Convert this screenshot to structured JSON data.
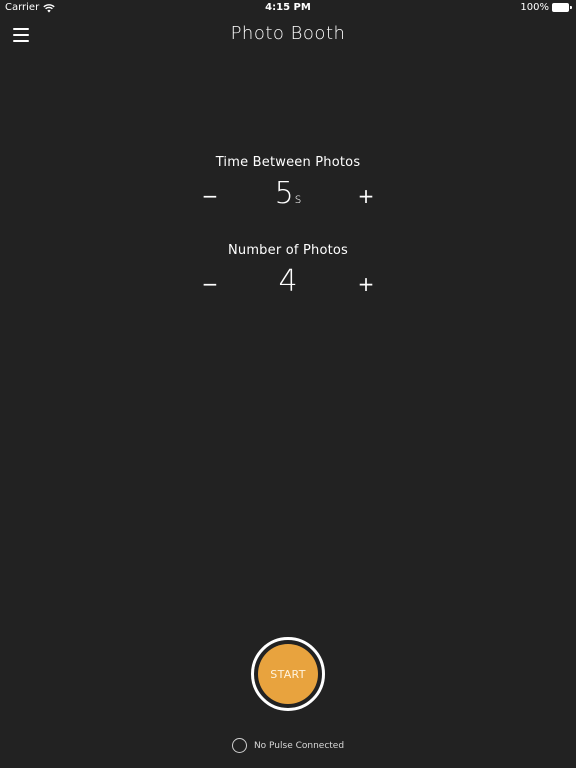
{
  "status_bar": {
    "carrier": "Carrier",
    "time": "4:15 PM",
    "battery": "100%"
  },
  "header": {
    "title": "Photo Booth"
  },
  "settings": {
    "time_between": {
      "label": "Time Between Photos",
      "value": "5",
      "unit": "s",
      "decrement": "−",
      "increment": "+"
    },
    "number_of_photos": {
      "label": "Number of Photos",
      "value": "4",
      "decrement": "−",
      "increment": "+"
    }
  },
  "start_button": {
    "label": "START",
    "color": "#e8a33e"
  },
  "pulse": {
    "status": "No Pulse Connected"
  },
  "colors": {
    "background": "#222222",
    "accent": "#e8a33e"
  }
}
